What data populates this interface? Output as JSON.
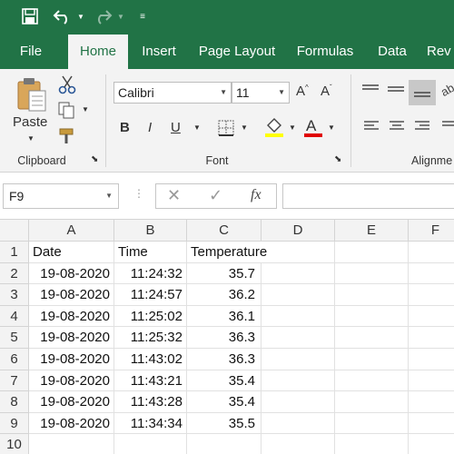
{
  "tabs": [
    "File",
    "Home",
    "Insert",
    "Page Layout",
    "Formulas",
    "Data",
    "Rev"
  ],
  "active_tab": "Home",
  "ribbon": {
    "paste_label": "Paste",
    "clipboard_label": "Clipboard",
    "font_name": "Calibri",
    "font_size": "11",
    "font_label": "Font",
    "alignment_label": "Alignme"
  },
  "formula_bar": {
    "name_box": "F9",
    "fx_label": "fx"
  },
  "grid": {
    "columns": [
      "A",
      "B",
      "C",
      "D",
      "E",
      "F"
    ],
    "rows": [
      "1",
      "2",
      "3",
      "4",
      "5",
      "6",
      "7",
      "8",
      "9",
      "10"
    ],
    "header": [
      "Date",
      "Time",
      "Temperature"
    ],
    "data": [
      [
        "19-08-2020",
        "11:24:32",
        "35.7"
      ],
      [
        "19-08-2020",
        "11:24:57",
        "36.2"
      ],
      [
        "19-08-2020",
        "11:25:02",
        "36.1"
      ],
      [
        "19-08-2020",
        "11:25:32",
        "36.3"
      ],
      [
        "19-08-2020",
        "11:43:02",
        "36.3"
      ],
      [
        "19-08-2020",
        "11:43:21",
        "35.4"
      ],
      [
        "19-08-2020",
        "11:43:28",
        "35.4"
      ],
      [
        "19-08-2020",
        "11:34:34",
        "35.5"
      ]
    ]
  },
  "colors": {
    "excel_green": "#217346",
    "ribbon_bg": "#f3f3f3",
    "highlight_yellow": "#ffff00",
    "font_red": "#e00000"
  }
}
